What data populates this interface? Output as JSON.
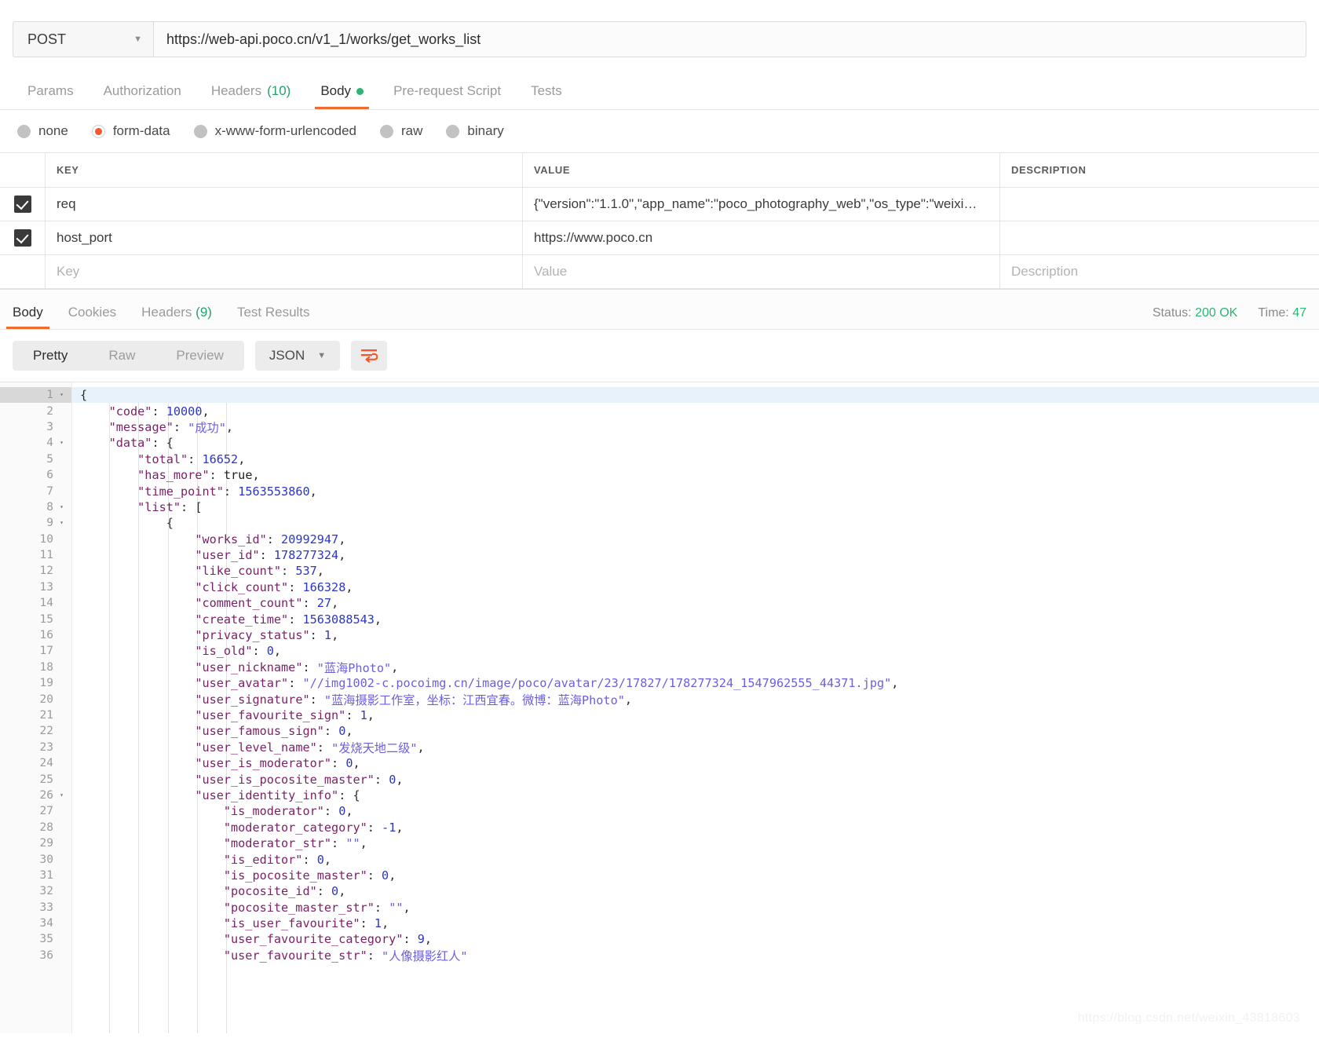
{
  "request": {
    "method": "POST",
    "method_caret": "▼",
    "url": "https://web-api.poco.cn/v1_1/works/get_works_list",
    "tabs": [
      {
        "label": "Params",
        "active": false,
        "count": "",
        "dot": false
      },
      {
        "label": "Authorization",
        "active": false,
        "count": "",
        "dot": false
      },
      {
        "label": "Headers",
        "active": false,
        "count": "(10)",
        "dot": false
      },
      {
        "label": "Body",
        "active": true,
        "count": "",
        "dot": true
      },
      {
        "label": "Pre-request Script",
        "active": false,
        "count": "",
        "dot": false
      },
      {
        "label": "Tests",
        "active": false,
        "count": "",
        "dot": false
      }
    ],
    "body_types": [
      {
        "label": "none",
        "selected": false
      },
      {
        "label": "form-data",
        "selected": true
      },
      {
        "label": "x-www-form-urlencoded",
        "selected": false
      },
      {
        "label": "raw",
        "selected": false
      },
      {
        "label": "binary",
        "selected": false
      }
    ],
    "table": {
      "headers": {
        "key": "KEY",
        "value": "VALUE",
        "description": "DESCRIPTION"
      },
      "rows": [
        {
          "checked": true,
          "key": "req",
          "value": "{\"version\":\"1.1.0\",\"app_name\":\"poco_photography_web\",\"os_type\":\"weixi…",
          "description": ""
        },
        {
          "checked": true,
          "key": "host_port",
          "value": "https://www.poco.cn",
          "description": ""
        }
      ],
      "placeholders": {
        "key": "Key",
        "value": "Value",
        "description": "Description"
      }
    }
  },
  "response": {
    "tabs": [
      {
        "label": "Body",
        "active": true,
        "count": ""
      },
      {
        "label": "Cookies",
        "active": false,
        "count": ""
      },
      {
        "label": "Headers",
        "active": false,
        "count": "(9)"
      },
      {
        "label": "Test Results",
        "active": false,
        "count": ""
      }
    ],
    "status_label": "Status:",
    "status_value": "200 OK",
    "time_label": "Time:",
    "time_value": "47",
    "viewer": {
      "modes": [
        {
          "label": "Pretty",
          "active": true
        },
        {
          "label": "Raw",
          "active": false
        },
        {
          "label": "Preview",
          "active": false
        }
      ],
      "format": "JSON",
      "format_caret": "▼",
      "wrap_icon": "word-wrap-icon"
    },
    "code_lines": [
      {
        "n": 1,
        "fold": "▾",
        "indent": 0,
        "tokens": [
          {
            "t": "pun",
            "v": "{"
          }
        ]
      },
      {
        "n": 2,
        "fold": "",
        "indent": 1,
        "tokens": [
          {
            "t": "key",
            "v": "\"code\""
          },
          {
            "t": "pun",
            "v": ": "
          },
          {
            "t": "num",
            "v": "10000"
          },
          {
            "t": "pun",
            "v": ","
          }
        ]
      },
      {
        "n": 3,
        "fold": "",
        "indent": 1,
        "tokens": [
          {
            "t": "key",
            "v": "\"message\""
          },
          {
            "t": "pun",
            "v": ": "
          },
          {
            "t": "str",
            "v": "\"成功\""
          },
          {
            "t": "pun",
            "v": ","
          }
        ]
      },
      {
        "n": 4,
        "fold": "▾",
        "indent": 1,
        "tokens": [
          {
            "t": "key",
            "v": "\"data\""
          },
          {
            "t": "pun",
            "v": ": {"
          }
        ]
      },
      {
        "n": 5,
        "fold": "",
        "indent": 2,
        "tokens": [
          {
            "t": "key",
            "v": "\"total\""
          },
          {
            "t": "pun",
            "v": ": "
          },
          {
            "t": "num",
            "v": "16652"
          },
          {
            "t": "pun",
            "v": ","
          }
        ]
      },
      {
        "n": 6,
        "fold": "",
        "indent": 2,
        "tokens": [
          {
            "t": "key",
            "v": "\"has_more\""
          },
          {
            "t": "pun",
            "v": ": "
          },
          {
            "t": "bool",
            "v": "true"
          },
          {
            "t": "pun",
            "v": ","
          }
        ]
      },
      {
        "n": 7,
        "fold": "",
        "indent": 2,
        "tokens": [
          {
            "t": "key",
            "v": "\"time_point\""
          },
          {
            "t": "pun",
            "v": ": "
          },
          {
            "t": "num",
            "v": "1563553860"
          },
          {
            "t": "pun",
            "v": ","
          }
        ]
      },
      {
        "n": 8,
        "fold": "▾",
        "indent": 2,
        "tokens": [
          {
            "t": "key",
            "v": "\"list\""
          },
          {
            "t": "pun",
            "v": ": ["
          }
        ]
      },
      {
        "n": 9,
        "fold": "▾",
        "indent": 3,
        "tokens": [
          {
            "t": "pun",
            "v": "{"
          }
        ]
      },
      {
        "n": 10,
        "fold": "",
        "indent": 4,
        "tokens": [
          {
            "t": "key",
            "v": "\"works_id\""
          },
          {
            "t": "pun",
            "v": ": "
          },
          {
            "t": "num",
            "v": "20992947"
          },
          {
            "t": "pun",
            "v": ","
          }
        ]
      },
      {
        "n": 11,
        "fold": "",
        "indent": 4,
        "tokens": [
          {
            "t": "key",
            "v": "\"user_id\""
          },
          {
            "t": "pun",
            "v": ": "
          },
          {
            "t": "num",
            "v": "178277324"
          },
          {
            "t": "pun",
            "v": ","
          }
        ]
      },
      {
        "n": 12,
        "fold": "",
        "indent": 4,
        "tokens": [
          {
            "t": "key",
            "v": "\"like_count\""
          },
          {
            "t": "pun",
            "v": ": "
          },
          {
            "t": "num",
            "v": "537"
          },
          {
            "t": "pun",
            "v": ","
          }
        ]
      },
      {
        "n": 13,
        "fold": "",
        "indent": 4,
        "tokens": [
          {
            "t": "key",
            "v": "\"click_count\""
          },
          {
            "t": "pun",
            "v": ": "
          },
          {
            "t": "num",
            "v": "166328"
          },
          {
            "t": "pun",
            "v": ","
          }
        ]
      },
      {
        "n": 14,
        "fold": "",
        "indent": 4,
        "tokens": [
          {
            "t": "key",
            "v": "\"comment_count\""
          },
          {
            "t": "pun",
            "v": ": "
          },
          {
            "t": "num",
            "v": "27"
          },
          {
            "t": "pun",
            "v": ","
          }
        ]
      },
      {
        "n": 15,
        "fold": "",
        "indent": 4,
        "tokens": [
          {
            "t": "key",
            "v": "\"create_time\""
          },
          {
            "t": "pun",
            "v": ": "
          },
          {
            "t": "num",
            "v": "1563088543"
          },
          {
            "t": "pun",
            "v": ","
          }
        ]
      },
      {
        "n": 16,
        "fold": "",
        "indent": 4,
        "tokens": [
          {
            "t": "key",
            "v": "\"privacy_status\""
          },
          {
            "t": "pun",
            "v": ": "
          },
          {
            "t": "num",
            "v": "1"
          },
          {
            "t": "pun",
            "v": ","
          }
        ]
      },
      {
        "n": 17,
        "fold": "",
        "indent": 4,
        "tokens": [
          {
            "t": "key",
            "v": "\"is_old\""
          },
          {
            "t": "pun",
            "v": ": "
          },
          {
            "t": "num",
            "v": "0"
          },
          {
            "t": "pun",
            "v": ","
          }
        ]
      },
      {
        "n": 18,
        "fold": "",
        "indent": 4,
        "tokens": [
          {
            "t": "key",
            "v": "\"user_nickname\""
          },
          {
            "t": "pun",
            "v": ": "
          },
          {
            "t": "str",
            "v": "\"蓝海Photo\""
          },
          {
            "t": "pun",
            "v": ","
          }
        ]
      },
      {
        "n": 19,
        "fold": "",
        "indent": 4,
        "tokens": [
          {
            "t": "key",
            "v": "\"user_avatar\""
          },
          {
            "t": "pun",
            "v": ": "
          },
          {
            "t": "str",
            "v": "\"//img1002-c.pocoimg.cn/image/poco/avatar/23/17827/178277324_1547962555_44371.jpg\""
          },
          {
            "t": "pun",
            "v": ","
          }
        ]
      },
      {
        "n": 20,
        "fold": "",
        "indent": 4,
        "tokens": [
          {
            "t": "key",
            "v": "\"user_signature\""
          },
          {
            "t": "pun",
            "v": ": "
          },
          {
            "t": "str",
            "v": "\"蓝海摄影工作室，坐标：江西宜春。微博：蓝海Photo\""
          },
          {
            "t": "pun",
            "v": ","
          }
        ]
      },
      {
        "n": 21,
        "fold": "",
        "indent": 4,
        "tokens": [
          {
            "t": "key",
            "v": "\"user_favourite_sign\""
          },
          {
            "t": "pun",
            "v": ": "
          },
          {
            "t": "num",
            "v": "1"
          },
          {
            "t": "pun",
            "v": ","
          }
        ]
      },
      {
        "n": 22,
        "fold": "",
        "indent": 4,
        "tokens": [
          {
            "t": "key",
            "v": "\"user_famous_sign\""
          },
          {
            "t": "pun",
            "v": ": "
          },
          {
            "t": "num",
            "v": "0"
          },
          {
            "t": "pun",
            "v": ","
          }
        ]
      },
      {
        "n": 23,
        "fold": "",
        "indent": 4,
        "tokens": [
          {
            "t": "key",
            "v": "\"user_level_name\""
          },
          {
            "t": "pun",
            "v": ": "
          },
          {
            "t": "str",
            "v": "\"发烧天地二级\""
          },
          {
            "t": "pun",
            "v": ","
          }
        ]
      },
      {
        "n": 24,
        "fold": "",
        "indent": 4,
        "tokens": [
          {
            "t": "key",
            "v": "\"user_is_moderator\""
          },
          {
            "t": "pun",
            "v": ": "
          },
          {
            "t": "num",
            "v": "0"
          },
          {
            "t": "pun",
            "v": ","
          }
        ]
      },
      {
        "n": 25,
        "fold": "",
        "indent": 4,
        "tokens": [
          {
            "t": "key",
            "v": "\"user_is_pocosite_master\""
          },
          {
            "t": "pun",
            "v": ": "
          },
          {
            "t": "num",
            "v": "0"
          },
          {
            "t": "pun",
            "v": ","
          }
        ]
      },
      {
        "n": 26,
        "fold": "▾",
        "indent": 4,
        "tokens": [
          {
            "t": "key",
            "v": "\"user_identity_info\""
          },
          {
            "t": "pun",
            "v": ": {"
          }
        ]
      },
      {
        "n": 27,
        "fold": "",
        "indent": 5,
        "tokens": [
          {
            "t": "key",
            "v": "\"is_moderator\""
          },
          {
            "t": "pun",
            "v": ": "
          },
          {
            "t": "num",
            "v": "0"
          },
          {
            "t": "pun",
            "v": ","
          }
        ]
      },
      {
        "n": 28,
        "fold": "",
        "indent": 5,
        "tokens": [
          {
            "t": "key",
            "v": "\"moderator_category\""
          },
          {
            "t": "pun",
            "v": ": "
          },
          {
            "t": "num",
            "v": "-1"
          },
          {
            "t": "pun",
            "v": ","
          }
        ]
      },
      {
        "n": 29,
        "fold": "",
        "indent": 5,
        "tokens": [
          {
            "t": "key",
            "v": "\"moderator_str\""
          },
          {
            "t": "pun",
            "v": ": "
          },
          {
            "t": "str",
            "v": "\"\""
          },
          {
            "t": "pun",
            "v": ","
          }
        ]
      },
      {
        "n": 30,
        "fold": "",
        "indent": 5,
        "tokens": [
          {
            "t": "key",
            "v": "\"is_editor\""
          },
          {
            "t": "pun",
            "v": ": "
          },
          {
            "t": "num",
            "v": "0"
          },
          {
            "t": "pun",
            "v": ","
          }
        ]
      },
      {
        "n": 31,
        "fold": "",
        "indent": 5,
        "tokens": [
          {
            "t": "key",
            "v": "\"is_pocosite_master\""
          },
          {
            "t": "pun",
            "v": ": "
          },
          {
            "t": "num",
            "v": "0"
          },
          {
            "t": "pun",
            "v": ","
          }
        ]
      },
      {
        "n": 32,
        "fold": "",
        "indent": 5,
        "tokens": [
          {
            "t": "key",
            "v": "\"pocosite_id\""
          },
          {
            "t": "pun",
            "v": ": "
          },
          {
            "t": "num",
            "v": "0"
          },
          {
            "t": "pun",
            "v": ","
          }
        ]
      },
      {
        "n": 33,
        "fold": "",
        "indent": 5,
        "tokens": [
          {
            "t": "key",
            "v": "\"pocosite_master_str\""
          },
          {
            "t": "pun",
            "v": ": "
          },
          {
            "t": "str",
            "v": "\"\""
          },
          {
            "t": "pun",
            "v": ","
          }
        ]
      },
      {
        "n": 34,
        "fold": "",
        "indent": 5,
        "tokens": [
          {
            "t": "key",
            "v": "\"is_user_favourite\""
          },
          {
            "t": "pun",
            "v": ": "
          },
          {
            "t": "num",
            "v": "1"
          },
          {
            "t": "pun",
            "v": ","
          }
        ]
      },
      {
        "n": 35,
        "fold": "",
        "indent": 5,
        "tokens": [
          {
            "t": "key",
            "v": "\"user_favourite_category\""
          },
          {
            "t": "pun",
            "v": ": "
          },
          {
            "t": "num",
            "v": "9"
          },
          {
            "t": "pun",
            "v": ","
          }
        ]
      },
      {
        "n": 36,
        "fold": "",
        "indent": 5,
        "tokens": [
          {
            "t": "key",
            "v": "\"user_favourite_str\""
          },
          {
            "t": "pun",
            "v": ": "
          },
          {
            "t": "str",
            "v": "\"人像摄影红人\""
          }
        ]
      }
    ]
  },
  "watermark": "https://blog.csdn.net/weixin_43818603"
}
